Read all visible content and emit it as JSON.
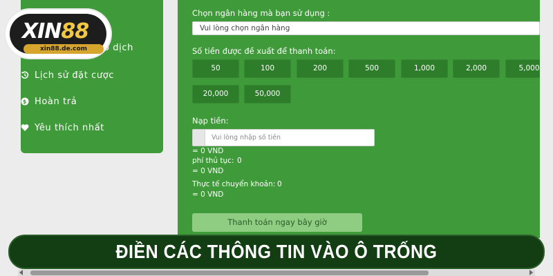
{
  "logo": {
    "brand_white": "XIN",
    "brand_yellow": "88",
    "url": "xin88.de.com"
  },
  "sidebar": {
    "partial_label": "o dịch",
    "items": [
      {
        "label": "Lịch sử đặt cược",
        "icon": "history-icon"
      },
      {
        "label": "Hoàn trả",
        "icon": "coin-icon"
      },
      {
        "label": "Yêu thích nhất",
        "icon": "heart-icon"
      }
    ]
  },
  "form": {
    "bank_label": "Chọn ngân hàng mà bạn sử dụng :",
    "bank_placeholder": "Vui lòng chọn ngân hàng",
    "suggested_label": "Số tiền được đề xuất để thanh toán:",
    "amounts": [
      "50",
      "100",
      "200",
      "500",
      "1,000",
      "2,000",
      "5,000",
      "20,000",
      "50,000"
    ],
    "deposit_label": "Nạp tiền:",
    "deposit_placeholder": "Vui lòng nhập số tiền",
    "deposit_value": "= 0 VND",
    "fee_label": "phí thủ tục:",
    "fee_amount": "0",
    "fee_value": "= 0 VND",
    "actual_label": "Thực tế chuyển khoản:",
    "actual_amount": "0",
    "actual_value": "= 0 VND",
    "pay_button": "Thanh toán ngay bây giờ"
  },
  "banner": {
    "title": "ĐIỀN CÁC THÔNG TIN VÀO Ô TRỐNG"
  },
  "colors": {
    "panel_green": "#3f9b3a",
    "button_green": "#2e7d2a",
    "banner_dark": "#133d13",
    "brand_gold": "#f2c744"
  }
}
